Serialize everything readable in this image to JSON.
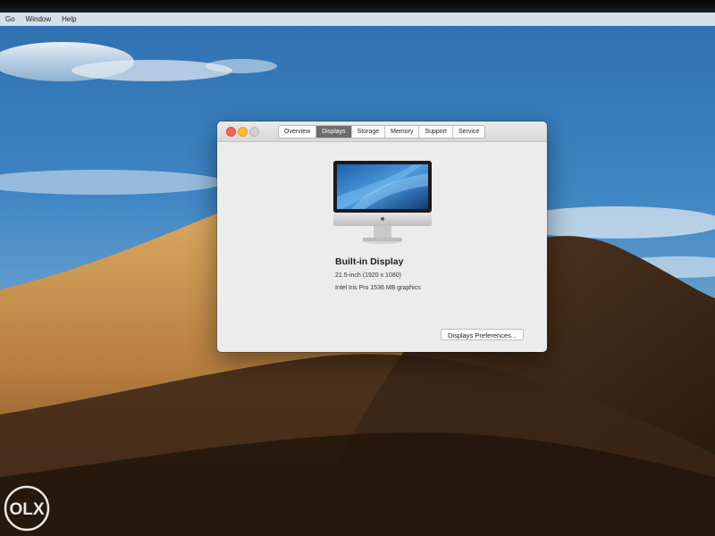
{
  "menubar": {
    "items": [
      "Go",
      "Window",
      "Help"
    ]
  },
  "window": {
    "tabs": [
      {
        "label": "Overview",
        "active": false
      },
      {
        "label": "Displays",
        "active": true
      },
      {
        "label": "Storage",
        "active": false
      },
      {
        "label": "Memory",
        "active": false
      },
      {
        "label": "Support",
        "active": false
      },
      {
        "label": "Service",
        "active": false
      }
    ],
    "display": {
      "title": "Built-in Display",
      "resolution": "21.5-inch (1920 x 1080)",
      "graphics": "Intel Iris Pro 1536 MB graphics"
    },
    "preferences_button": "Displays Preferences..."
  },
  "icons": {
    "device": "imac-icon",
    "watermark": "olx-logo"
  },
  "colors": {
    "close": "#fc5f57",
    "minimize": "#fdbc2e",
    "zoom": "#cfcfcf",
    "active_tab": "#6b6b6b"
  },
  "watermark": {
    "text": "OLX"
  }
}
